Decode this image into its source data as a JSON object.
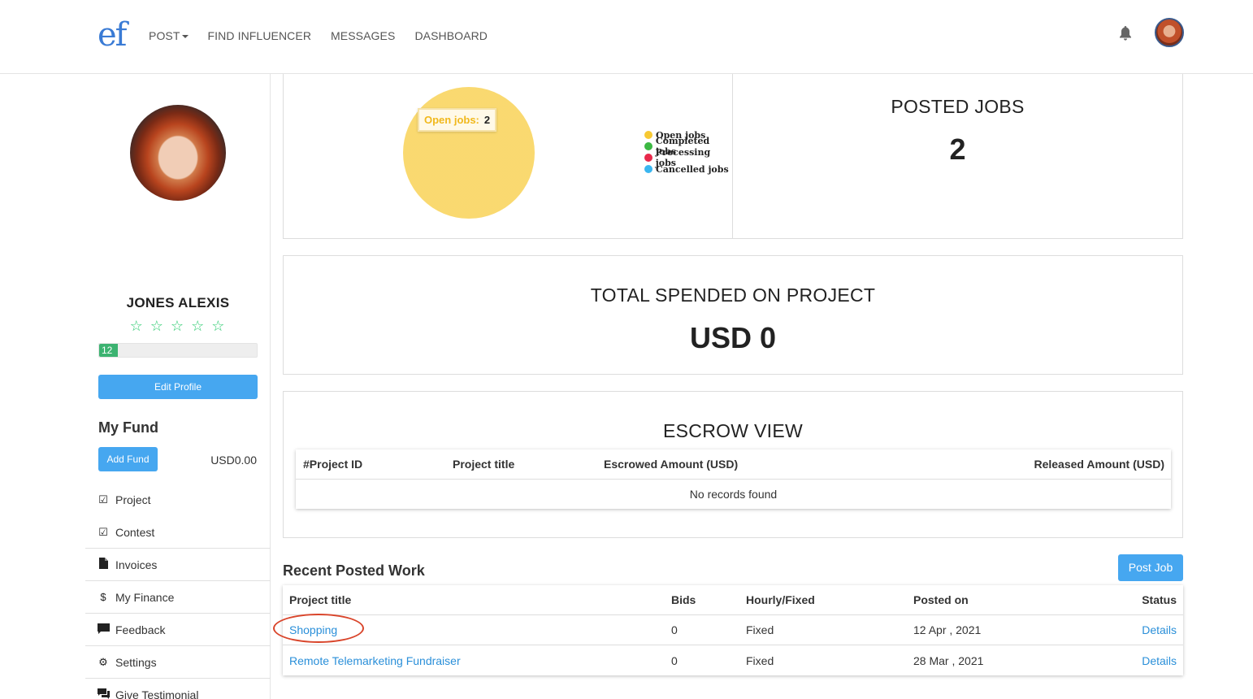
{
  "header": {
    "logo": "ef",
    "nav": [
      "POST",
      "FIND INFLUENCER",
      "MESSAGES",
      "DASHBOARD"
    ]
  },
  "sidebar": {
    "name": "JONES ALEXIS",
    "stars": "☆ ☆ ☆ ☆ ☆",
    "progress_label": "12",
    "progress_value": 0.12,
    "edit_profile": "Edit Profile",
    "fund_title": "My Fund",
    "add_fund": "Add Fund",
    "fund_amount": "USD0.00",
    "menu": [
      {
        "label": "Project",
        "icon": "checkbox-icon"
      },
      {
        "label": "Contest",
        "icon": "checkbox-icon"
      },
      {
        "label": "Invoices",
        "icon": "file-icon"
      },
      {
        "label": "My Finance",
        "icon": "dollar-icon"
      },
      {
        "label": "Feedback",
        "icon": "comment-icon"
      },
      {
        "label": "Settings",
        "icon": "gear-icon"
      },
      {
        "label": "Give Testimonial",
        "icon": "comments-icon"
      }
    ]
  },
  "chart_data": {
    "type": "pie",
    "title": "",
    "categories": [
      "Open jobs",
      "Completed jobs",
      "Processing jobs",
      "Cancelled jobs"
    ],
    "values": [
      2,
      0,
      0,
      0
    ],
    "colors": [
      "#f7c933",
      "#3cb843",
      "#e8294b",
      "#3ab6f0"
    ],
    "tooltip": {
      "label": "Open jobs:",
      "value": "2"
    },
    "legend_position": "right"
  },
  "posted_jobs": {
    "title": "POSTED JOBS",
    "value": "2"
  },
  "total_spent": {
    "title": "TOTAL SPENDED ON PROJECT",
    "value": "USD 0"
  },
  "escrow": {
    "title": "ESCROW VIEW",
    "columns": [
      "#Project ID",
      "Project title",
      "Escrowed Amount (USD)",
      "Released Amount (USD)"
    ],
    "empty": "No records found"
  },
  "recent": {
    "title": "Recent Posted Work",
    "post_job": "Post Job",
    "columns": [
      "Project title",
      "Bids",
      "Hourly/Fixed",
      "Posted on",
      "Status"
    ],
    "rows": [
      {
        "title": "Shopping",
        "bids": "0",
        "type": "Fixed",
        "posted": "12 Apr , 2021",
        "status": "Details"
      },
      {
        "title": "Remote Telemarketing Fundraiser",
        "bids": "0",
        "type": "Fixed",
        "posted": "28 Mar , 2021",
        "status": "Details"
      }
    ]
  }
}
